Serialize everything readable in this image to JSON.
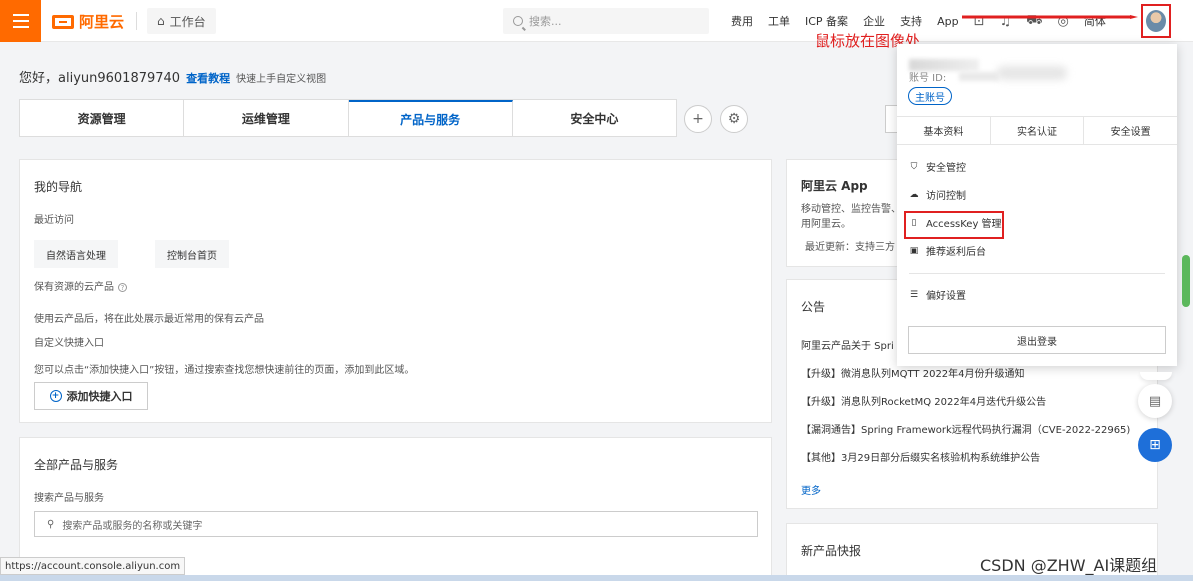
{
  "topbar": {
    "logo_text": "阿里云",
    "workbench": "工作台",
    "search_placeholder": "搜索...",
    "nav": [
      "费用",
      "工单",
      "ICP 备案",
      "企业",
      "支持",
      "App"
    ],
    "lang": "简体",
    "accent": "#ff6a00"
  },
  "annotation": {
    "caption": "鼠标放在图像处",
    "color": "#e02020"
  },
  "greeting": {
    "text": "您好，aliyun9601879740",
    "link": "查看教程",
    "hint": "快速上手自定义视图"
  },
  "tabs": [
    {
      "label": "资源管理",
      "active": false
    },
    {
      "label": "运维管理",
      "active": false
    },
    {
      "label": "产品与服务",
      "active": true
    },
    {
      "label": "安全中心",
      "active": false
    }
  ],
  "nav_card": {
    "title": "我的导航",
    "recent": "最近访问",
    "chips": [
      "自然语言处理",
      "控制台首页"
    ],
    "kept_title": "保有资源的云产品",
    "kept_desc": "使用云产品后，将在此处展示最近常用的保有云产品",
    "shortcut_title": "自定义快捷入口",
    "shortcut_desc": "您可以点击“添加快捷入口”按钮，通过搜索查找您想快速前往的页面，添加到此区域。",
    "add_button": "添加快捷入口"
  },
  "all_card": {
    "title": "全部产品与服务",
    "search_label": "搜索产品与服务",
    "search_placeholder": "搜索产品或服务的名称或关键字"
  },
  "app_card": {
    "title": "阿里云 App",
    "desc1": "移动管控、监控告警、",
    "desc2": "用阿里云。",
    "update": "最近更新：支持三方"
  },
  "notice_card": {
    "title": "公告",
    "items": [
      "阿里云产品关于 Spri",
      "【升级】微消息队列MQTT 2022年4月份升级通知",
      "【升级】消息队列RocketMQ 2022年4月迭代升级公告",
      "【漏洞通告】Spring Framework远程代码执行漏洞（CVE-2022-22965)",
      "【其他】3月29日部分后缀实名核验机构系统维护公告"
    ],
    "more": "更多"
  },
  "new_card": {
    "title": "新产品快报"
  },
  "dropdown": {
    "account_id_label": "账号 ID:",
    "badge": "主账号",
    "tabs": [
      "基本资料",
      "实名认证",
      "安全设置"
    ],
    "items": [
      "安全管控",
      "访问控制",
      "AccessKey 管理",
      "推荐返利后台"
    ],
    "prefs": "偏好设置",
    "logout": "退出登录"
  },
  "status_url": "https://account.console.aliyun.com",
  "watermark": "CSDN @ZHW_AI课题组"
}
